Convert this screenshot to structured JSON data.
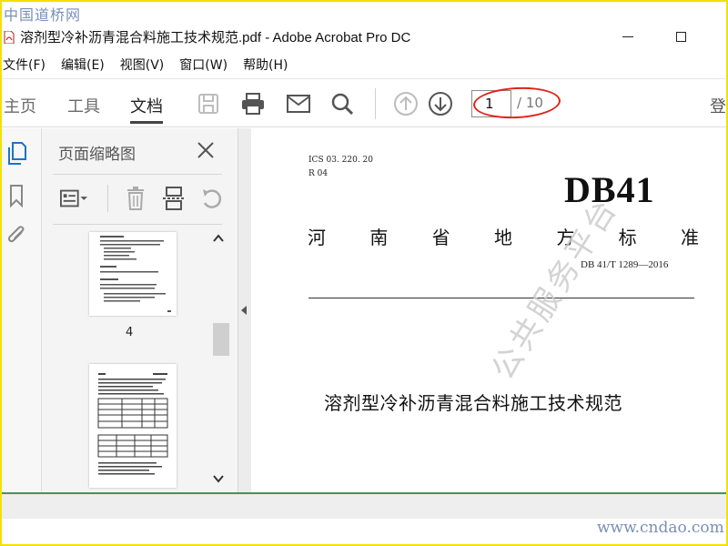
{
  "watermark": {
    "site_tag": "中国道桥网",
    "footer": "www.cndao.com",
    "doc_watermark": "公共服务平台"
  },
  "window": {
    "title": "溶剂型冷补沥青混合料施工技术规范.pdf - Adobe Acrobat Pro DC"
  },
  "menu": [
    "文件(F)",
    "编辑(E)",
    "视图(V)",
    "窗口(W)",
    "帮助(H)"
  ],
  "toolbar": {
    "tabs": [
      {
        "label": "主页"
      },
      {
        "label": "工具"
      },
      {
        "label": "文档",
        "active": true
      }
    ],
    "icons": [
      "save-icon",
      "print-icon",
      "email-icon",
      "search-icon",
      "page-up-icon",
      "page-down-icon"
    ],
    "page_current": "1",
    "page_total": "/ 10",
    "login_cut": "登"
  },
  "panel": {
    "title": "页面缩略图",
    "thumbs": [
      {
        "label": "4"
      },
      {
        "label": ""
      }
    ]
  },
  "document": {
    "ics_line1": "ICS  03. 220. 20",
    "ics_line2": "R  04",
    "code": "DB41",
    "province_chars": [
      "河",
      "南",
      "省",
      "地",
      "方",
      "标",
      "准"
    ],
    "std_number": "DB 41/T  1289—2016",
    "title": "溶剂型冷补沥青混合料施工技术规范"
  },
  "colors": {
    "frame": "#f2e200",
    "highlight_ellipse": "#e0241b",
    "active_blue": "#1a73c9",
    "status_green": "#4c8f5a"
  }
}
